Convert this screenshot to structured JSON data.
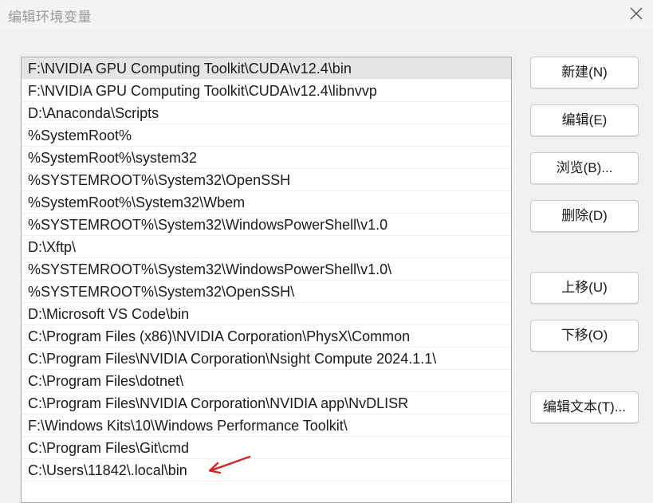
{
  "window": {
    "title": "编辑环境变量",
    "close_icon": "close-icon"
  },
  "paths": [
    "F:\\NVIDIA GPU Computing Toolkit\\CUDA\\v12.4\\bin",
    "F:\\NVIDIA GPU Computing Toolkit\\CUDA\\v12.4\\libnvvp",
    "D:\\Anaconda\\Scripts",
    "%SystemRoot%",
    "%SystemRoot%\\system32",
    "%SYSTEMROOT%\\System32\\OpenSSH",
    "%SystemRoot%\\System32\\Wbem",
    "%SYSTEMROOT%\\System32\\WindowsPowerShell\\v1.0",
    "D:\\Xftp\\",
    "%SYSTEMROOT%\\System32\\WindowsPowerShell\\v1.0\\",
    "%SYSTEMROOT%\\System32\\OpenSSH\\",
    "D:\\Microsoft VS Code\\bin",
    "C:\\Program Files (x86)\\NVIDIA Corporation\\PhysX\\Common",
    "C:\\Program Files\\NVIDIA Corporation\\Nsight Compute 2024.1.1\\",
    "C:\\Program Files\\dotnet\\",
    "C:\\Program Files\\NVIDIA Corporation\\NVIDIA app\\NvDLISR",
    "F:\\Windows Kits\\10\\Windows Performance Toolkit\\",
    "C:\\Program Files\\Git\\cmd",
    "C:\\Users\\11842\\.local\\bin"
  ],
  "selected_index": 0,
  "buttons": {
    "new": "新建(N)",
    "edit": "编辑(E)",
    "browse": "浏览(B)...",
    "delete": "删除(D)",
    "move_up": "上移(U)",
    "move_down": "下移(O)",
    "edit_text": "编辑文本(T)..."
  },
  "annotation": {
    "arrow_color": "#e02020",
    "arrow_icon": "red-arrow-icon"
  }
}
